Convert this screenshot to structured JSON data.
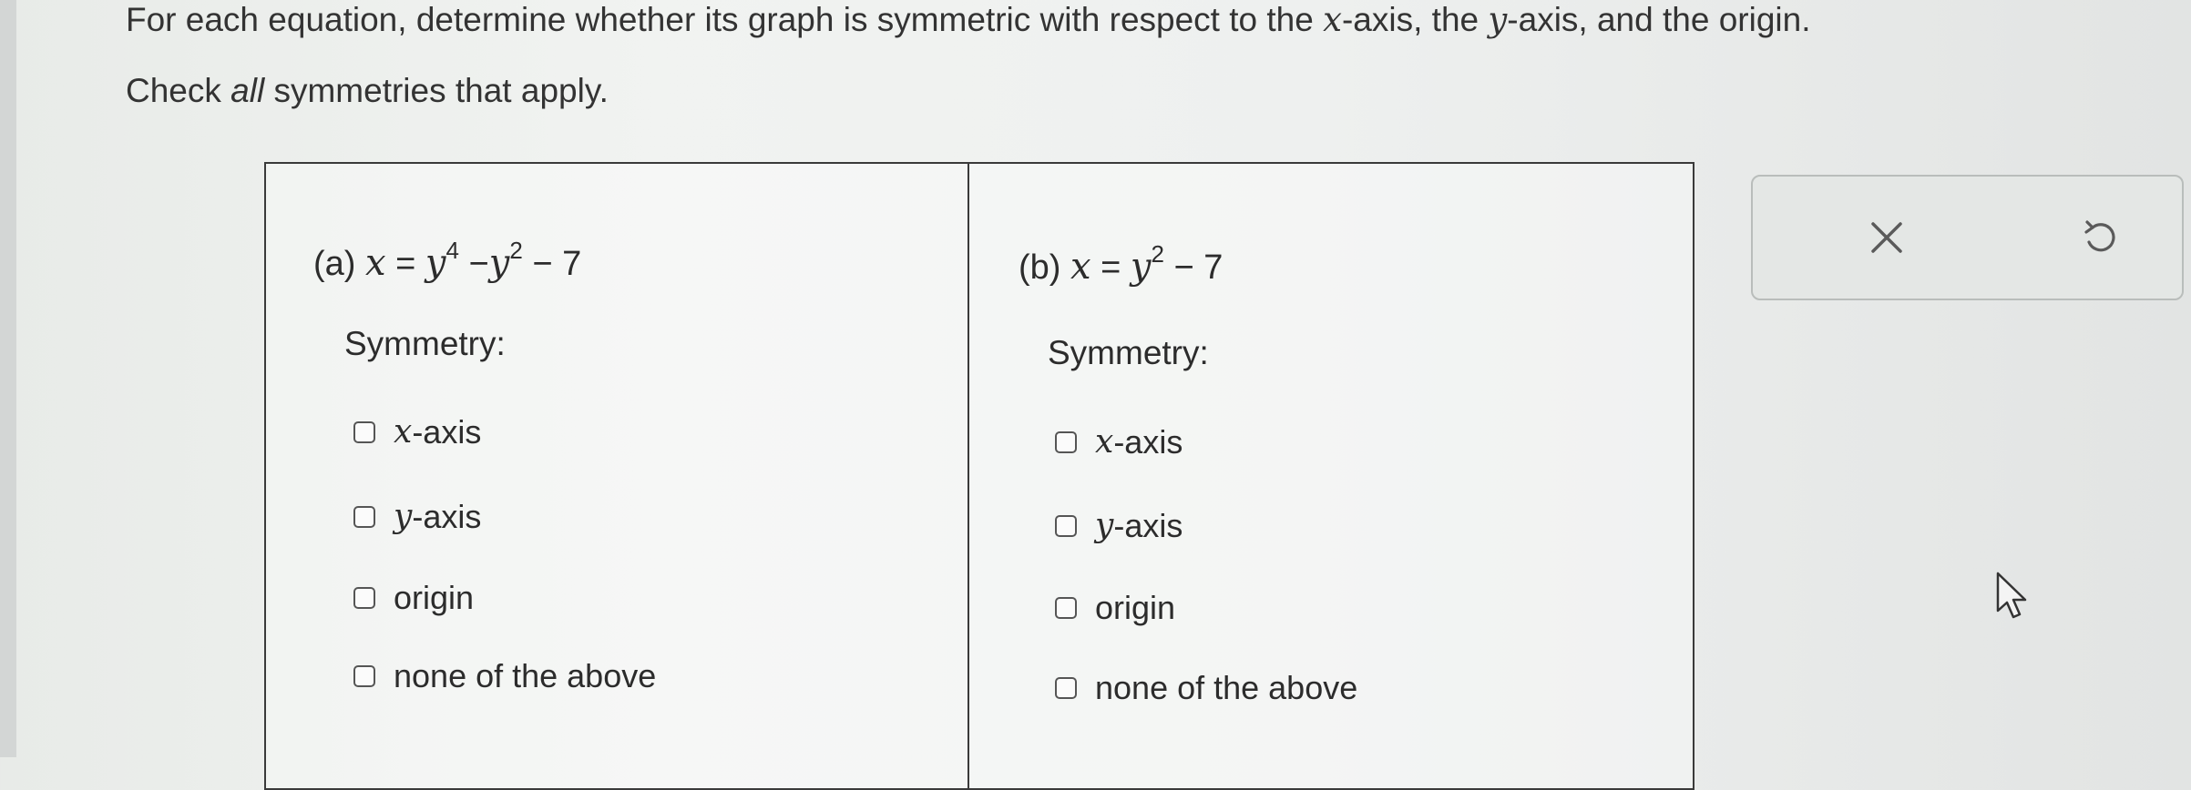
{
  "instructions": {
    "line1_part1": "For each equation, determine whether its graph is symmetric with respect to the ",
    "line1_var_x": "x",
    "line1_part2": "-axis, the ",
    "line1_var_y": "y",
    "line1_part3": "-axis, and the origin.",
    "line2_part1": "Check ",
    "line2_emph": "all",
    "line2_part2": " symmetries that apply."
  },
  "parts": [
    {
      "label": "(a)",
      "eq_lhs": "x",
      "eq_equals": "=",
      "eq_t1_base": "y",
      "eq_t1_exp": "4",
      "eq_minus1": "−",
      "eq_t2_base": "y",
      "eq_t2_exp": "2",
      "eq_const": "− 7",
      "symmetry_label": "Symmetry:",
      "options": [
        {
          "var": "x",
          "suffix": "-axis",
          "checked": false
        },
        {
          "var": "y",
          "suffix": "-axis",
          "checked": false
        },
        {
          "var": "",
          "suffix": "origin",
          "checked": false
        },
        {
          "var": "",
          "suffix": "none of the above",
          "checked": false
        }
      ]
    },
    {
      "label": "(b)",
      "eq_lhs": "x",
      "eq_equals": "=",
      "eq_t1_base": "y",
      "eq_t1_exp": "2",
      "eq_const": "− 7",
      "symmetry_label": "Symmetry:",
      "options": [
        {
          "var": "x",
          "suffix": "-axis",
          "checked": false
        },
        {
          "var": "y",
          "suffix": "-axis",
          "checked": false
        },
        {
          "var": "",
          "suffix": "origin",
          "checked": false
        },
        {
          "var": "",
          "suffix": "none of the above",
          "checked": false
        }
      ]
    }
  ],
  "toolbar": {
    "clear_icon": "close-icon",
    "undo_icon": "undo-icon"
  }
}
